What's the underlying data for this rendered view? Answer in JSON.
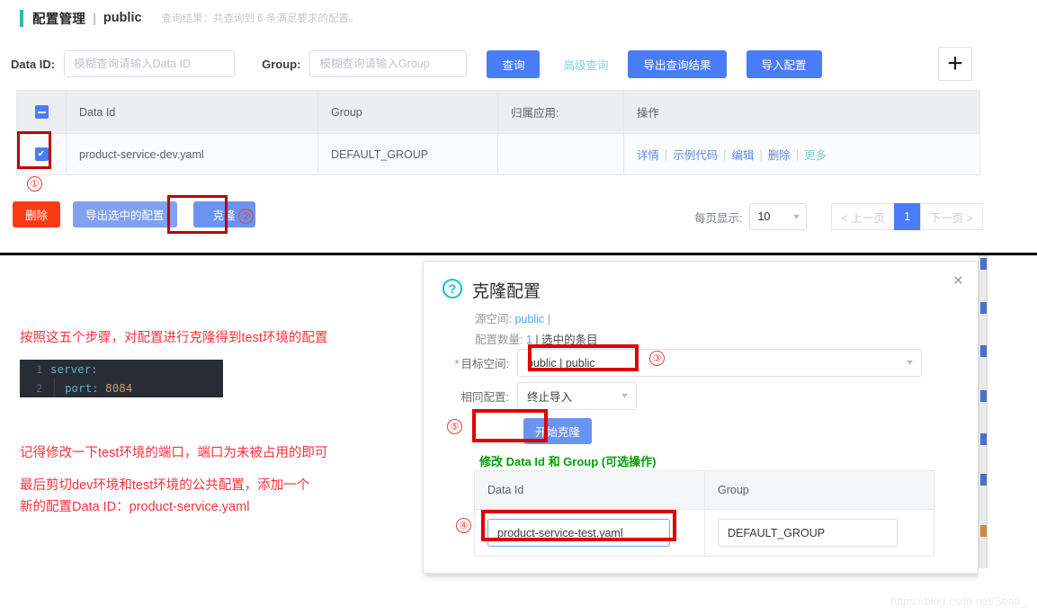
{
  "header": {
    "title": "配置管理",
    "separator": "|",
    "namespace": "public",
    "result_text": "查询结果：共查询到 6 条满足要求的配置。"
  },
  "search": {
    "dataid_label": "Data ID:",
    "dataid_placeholder": "模糊查询请输入Data ID",
    "group_label": "Group:",
    "group_placeholder": "模糊查询请输入Group",
    "query_button": "查询",
    "advanced_button": "高级查询",
    "export_button": "导出查询结果",
    "import_button": "导入配置",
    "add_icon": "+"
  },
  "table": {
    "columns": [
      "Data Id",
      "Group",
      "归属应用:",
      "操作"
    ],
    "rows": [
      {
        "data_id": "product-service-dev.yaml",
        "group": "DEFAULT_GROUP",
        "app": "",
        "actions": [
          "详情",
          "示例代码",
          "编辑",
          "删除",
          "更多"
        ],
        "action_separator": "|",
        "selected": true
      }
    ]
  },
  "toolbar": {
    "delete_button": "删除",
    "export_selected_button": "导出选中的配置",
    "clone_button": "克隆"
  },
  "pagination": {
    "per_page_label": "每页显示:",
    "per_page_value": "10",
    "prev_label": "< 上一页",
    "current_page": "1",
    "next_label": "下一页 >"
  },
  "annotations": {
    "step1": "①",
    "step2": "②",
    "step3": "③",
    "step4": "④",
    "step5": "⑤"
  },
  "notes": {
    "line1": "按照这五个步骤，对配置进行克隆得到test环境的配置",
    "line2": "记得修改一下test环境的端口，端口为未被占用的即可",
    "line3": "最后剪切dev环境和test环境的公共配置，添加一个",
    "line4": "新的配置Data ID：product-service.yaml"
  },
  "code_block": {
    "lines": [
      {
        "number": "1",
        "indent": "",
        "key": "server:",
        "value": ""
      },
      {
        "number": "2",
        "indent": "  ",
        "key": "port:",
        "value": "8084"
      }
    ]
  },
  "dialog": {
    "icon": "question-mark",
    "title": "克隆配置",
    "close_icon": "×",
    "source_label": "源空间:",
    "source_value": "public",
    "source_suffix": "|",
    "count_label": "配置数量:",
    "count_value": "1",
    "count_suffix": "| 选中的条目",
    "target_label": "目标空间:",
    "target_value": "public | public",
    "target_required": "*",
    "same_label": "相同配置:",
    "same_value": "终止导入",
    "start_button": "开始克隆",
    "green_note": "修改 Data Id 和 Group (可选操作)",
    "mini_table": {
      "columns": [
        "Data Id",
        "Group"
      ],
      "rows": [
        {
          "data_id": "product-service-test.yaml",
          "group": "DEFAULT_GROUP"
        }
      ]
    }
  },
  "watermark": "https://blog.csdn.net/Seati_",
  "colors": {
    "primary": "#4a7cf7",
    "danger": "#fb3b12",
    "teal": "#14c4b4",
    "annotation_red": "#ff2f3a",
    "green": "#00a000"
  }
}
